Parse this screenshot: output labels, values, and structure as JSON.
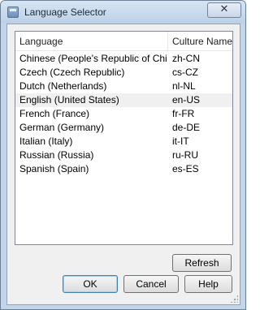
{
  "window": {
    "title": "Language Selector",
    "close_glyph": "✕"
  },
  "list": {
    "columns": [
      "Language",
      "Culture Name"
    ],
    "rows": [
      {
        "language": "Chinese (People's Republic of China)",
        "culture": "zh-CN"
      },
      {
        "language": "Czech (Czech Republic)",
        "culture": "cs-CZ"
      },
      {
        "language": "Dutch (Netherlands)",
        "culture": "nl-NL"
      },
      {
        "language": "English (United States)",
        "culture": "en-US",
        "selected": true
      },
      {
        "language": "French (France)",
        "culture": "fr-FR"
      },
      {
        "language": "German (Germany)",
        "culture": "de-DE"
      },
      {
        "language": "Italian (Italy)",
        "culture": "it-IT"
      },
      {
        "language": "Russian (Russia)",
        "culture": "ru-RU"
      },
      {
        "language": "Spanish (Spain)",
        "culture": "es-ES"
      }
    ]
  },
  "buttons": {
    "refresh": "Refresh",
    "ok": "OK",
    "cancel": "Cancel",
    "help": "Help"
  }
}
